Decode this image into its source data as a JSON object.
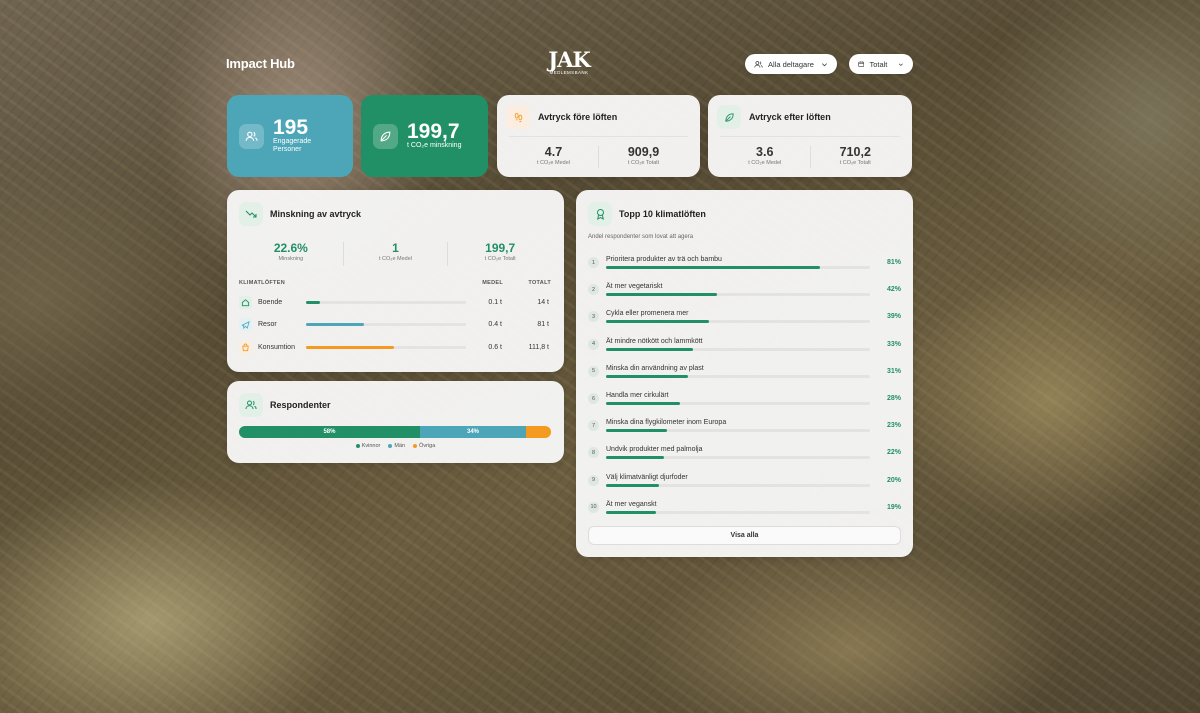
{
  "header": {
    "brand": "Impact Hub",
    "logo_mark": "JAK",
    "logo_sub": "MEDLEMSBANK",
    "filter_participants": "Alla deltagare",
    "filter_period": "Totalt"
  },
  "colors": {
    "teal": "#4da6b8",
    "green": "#229066",
    "orange": "#f59a20"
  },
  "stats": {
    "engaged": {
      "value": "195",
      "label1": "Engagerade",
      "label2": "Personer"
    },
    "reduction": {
      "value": "199,7",
      "label": "t CO₂e minskning"
    }
  },
  "before": {
    "title": "Avtryck före löften",
    "avg_value": "4.7",
    "avg_label": "t CO₂e Medel",
    "total_value": "909,9",
    "total_label": "t CO₂e Totalt"
  },
  "after": {
    "title": "Avtryck efter löften",
    "avg_value": "3.6",
    "avg_label": "t CO₂e Medel",
    "total_value": "710,2",
    "total_label": "t CO₂e Totalt"
  },
  "reduction_card": {
    "title": "Minskning av avtryck",
    "pct_value": "22.6%",
    "pct_label": "Minskning",
    "avg_value": "1",
    "avg_label": "t CO₂e Medel",
    "total_value": "199,7",
    "total_label": "t CO₂e Totalt",
    "col_category": "KLIMATLÖFTEN",
    "col_avg": "MEDEL",
    "col_total": "TOTALT",
    "rows": [
      {
        "label": "Boende",
        "avg": "0.1 t",
        "total": "14 t",
        "fill": 0.09,
        "color": "#229066"
      },
      {
        "label": "Resor",
        "avg": "0.4 t",
        "total": "81 t",
        "fill": 0.36,
        "color": "#4da6b8"
      },
      {
        "label": "Konsumtion",
        "avg": "0.6 t",
        "total": "111,8 t",
        "fill": 0.55,
        "color": "#f59a20"
      }
    ]
  },
  "respondents": {
    "title": "Respondenter",
    "segments": [
      {
        "label": "58%",
        "share": 0.58,
        "color": "#229066"
      },
      {
        "label": "34%",
        "share": 0.34,
        "color": "#4da6b8"
      },
      {
        "label": "",
        "share": 0.08,
        "color": "#f59a20"
      }
    ],
    "legend": [
      {
        "label": "Kvinnor",
        "color": "#229066"
      },
      {
        "label": "Män",
        "color": "#4da6b8"
      },
      {
        "label": "Övriga",
        "color": "#f59a20"
      }
    ]
  },
  "top10": {
    "title": "Topp 10 klimatlöften",
    "subtitle": "Andel respondenter som lovat att agera",
    "button": "Visa alla",
    "items": [
      {
        "num": "1",
        "label": "Prioritera produkter av trä och bambu",
        "pct": "81%",
        "value": 81
      },
      {
        "num": "2",
        "label": "Ät mer vegetariskt",
        "pct": "42%",
        "value": 42
      },
      {
        "num": "3",
        "label": "Cykla eller promenera mer",
        "pct": "39%",
        "value": 39
      },
      {
        "num": "4",
        "label": "Ät mindre nötkött och lammkött",
        "pct": "33%",
        "value": 33
      },
      {
        "num": "5",
        "label": "Minska din användning av plast",
        "pct": "31%",
        "value": 31
      },
      {
        "num": "6",
        "label": "Handla mer cirkulärt",
        "pct": "28%",
        "value": 28
      },
      {
        "num": "7",
        "label": "Minska dina flygkilometer inom Europa",
        "pct": "23%",
        "value": 23
      },
      {
        "num": "8",
        "label": "Undvik produkter med palmolja",
        "pct": "22%",
        "value": 22
      },
      {
        "num": "9",
        "label": "Välj klimatvänligt djurfoder",
        "pct": "20%",
        "value": 20
      },
      {
        "num": "10",
        "label": "Ät mer veganskt",
        "pct": "19%",
        "value": 19
      }
    ]
  }
}
